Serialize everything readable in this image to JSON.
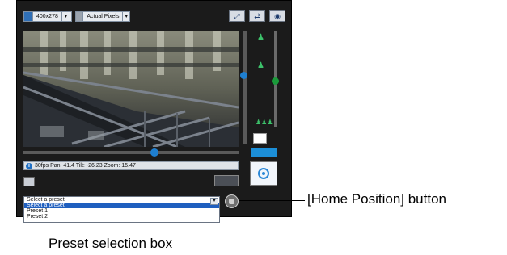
{
  "toolbar": {
    "resolution": "400x278",
    "view_mode": "Actual Pixels"
  },
  "status_bar": {
    "text": "30fps Pan: 41.4 Tilt: -26.23 Zoom: 15.47"
  },
  "preset": {
    "selected": "Select a preset",
    "options": [
      "Select a preset",
      "Preset 1",
      "Preset 2"
    ]
  },
  "callouts": {
    "home_button": "[Home Position] button",
    "preset_box": "Preset selection box"
  },
  "colors": {
    "panel": "#1b1b1b",
    "accent": "#1c8fd8",
    "zoom_green": "#3cc06a"
  }
}
